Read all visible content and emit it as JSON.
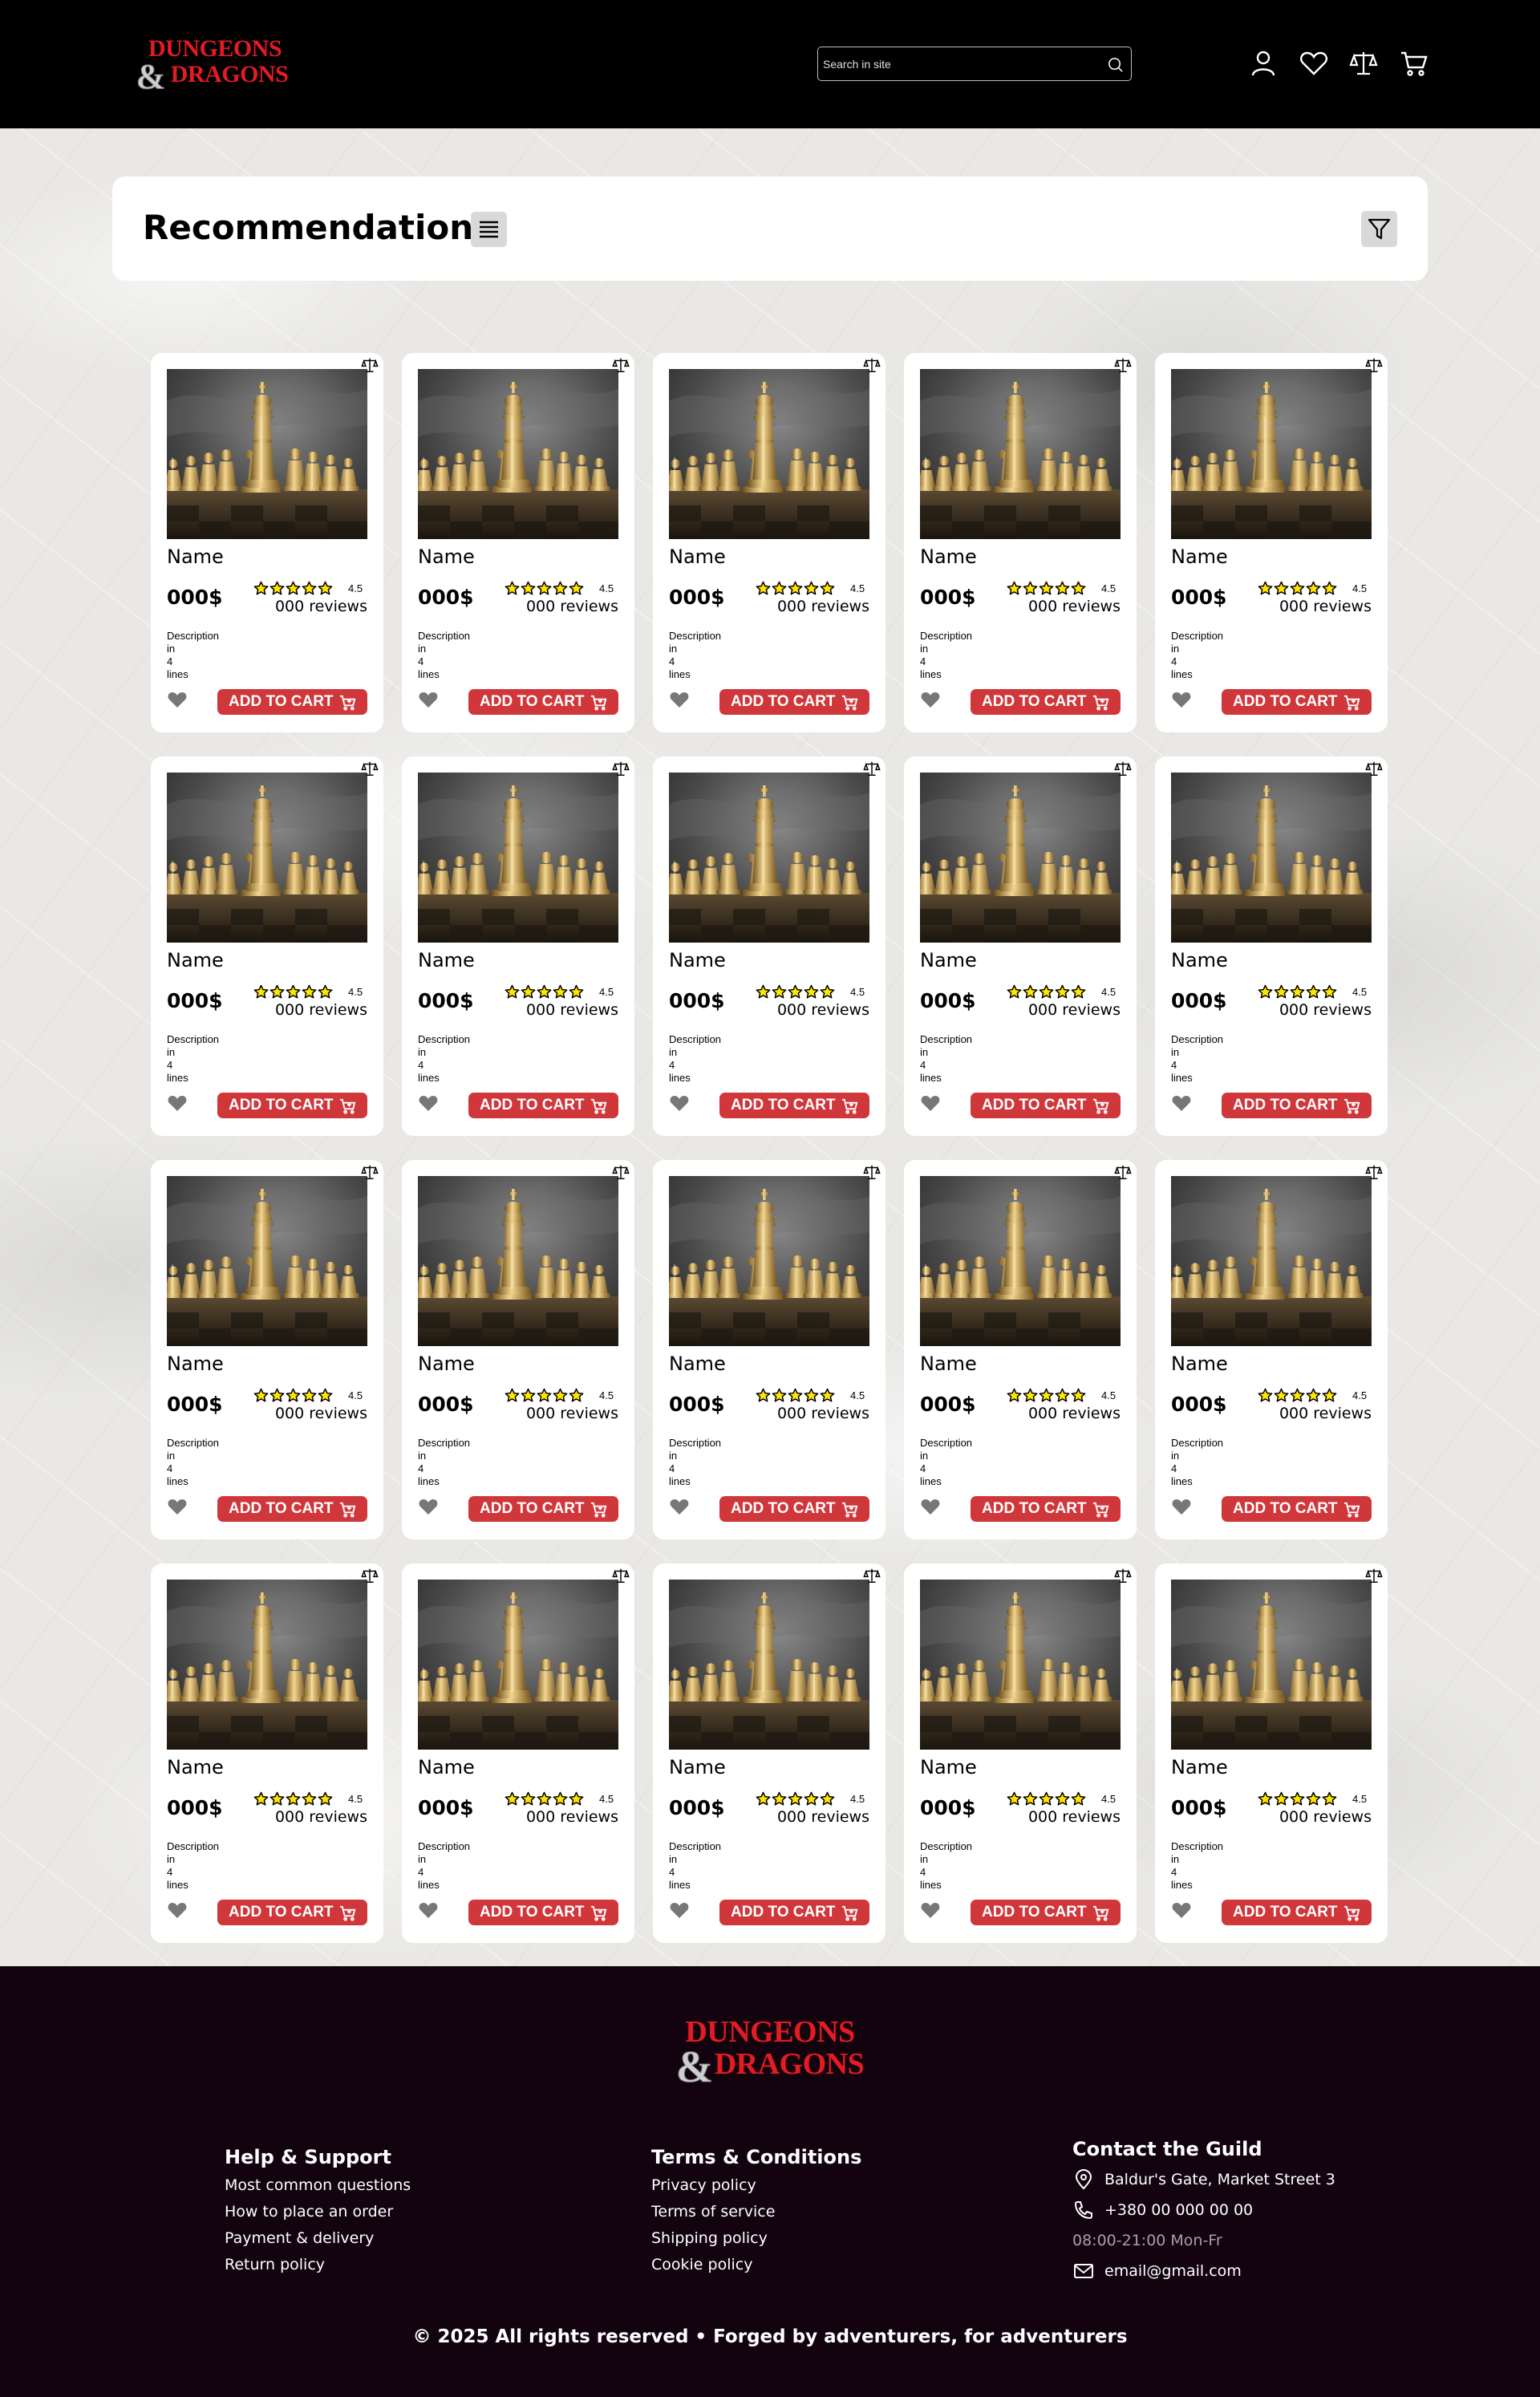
{
  "brand": {
    "logo_text": "DUNGEONS & DRAGONS",
    "accent": "#d0373b",
    "logo_red": "#e31b23"
  },
  "header": {
    "search_placeholder": "Search in site",
    "icons": [
      "user-icon",
      "heart-icon",
      "scales-icon",
      "cart-icon"
    ]
  },
  "recommendations": {
    "title": "Recommendations",
    "list_icon": "list-icon",
    "filter_icon": "filter-icon"
  },
  "product_card": {
    "name": "Name",
    "price": "000$",
    "rating": "4.5",
    "stars": 5,
    "reviews": "000 reviews",
    "description": [
      "Description",
      "in",
      "4",
      "lines"
    ],
    "add_to_cart": "ADD TO CART",
    "image": "chess-pieces-photo"
  },
  "product_count": 20,
  "footer": {
    "help": {
      "title": "Help & Support",
      "links": [
        "Most common questions",
        "How to place an order",
        "Payment & delivery",
        "Return policy"
      ]
    },
    "terms": {
      "title": "Terms & Conditions",
      "links": [
        "Privacy policy",
        "Terms of service",
        "Shipping policy",
        "Cookie policy"
      ]
    },
    "contact": {
      "title": "Contact the Guild",
      "address": "Baldur's Gate, Market Street 3",
      "phone": "+380 00 000 00 00",
      "hours": "08:00-21:00 Mon-Fr",
      "email": "email@gmail.com"
    },
    "copyright": "© 2025 All rights reserved • Forged by adventurers, for adventurers"
  }
}
